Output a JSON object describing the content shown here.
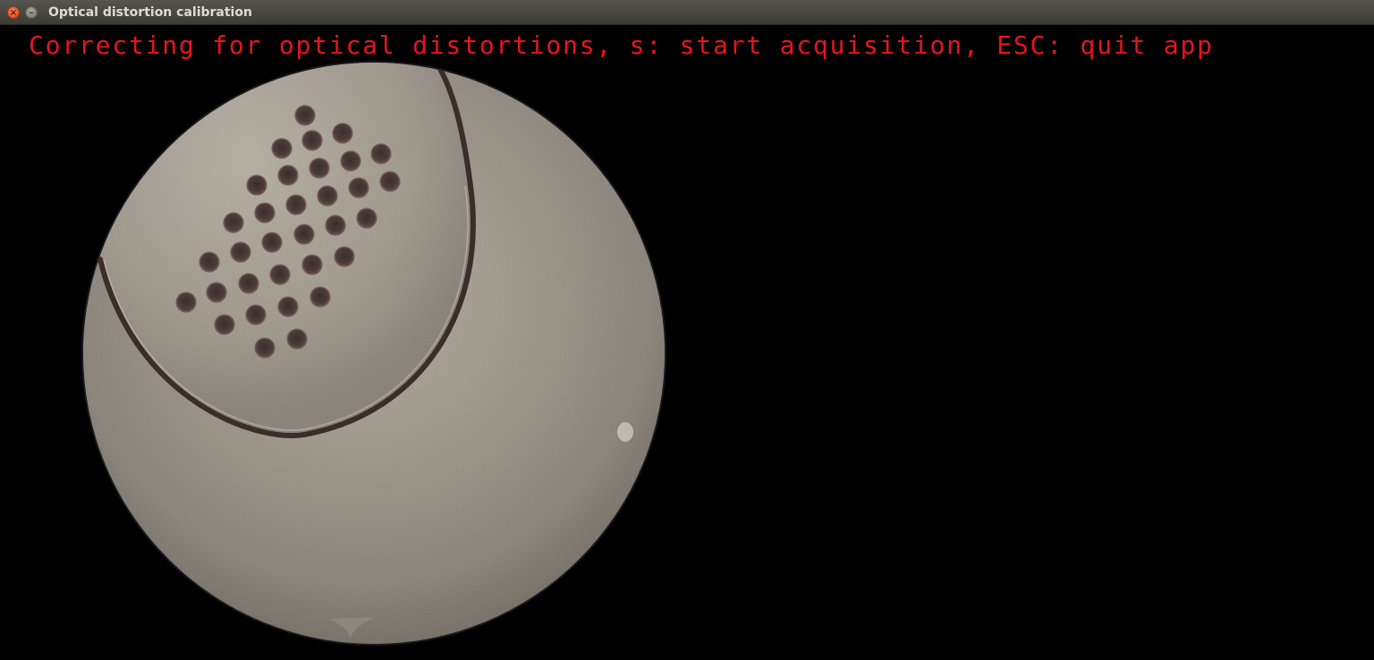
{
  "window": {
    "title": "Optical distortion calibration",
    "close_glyph": "×",
    "minimize_glyph": "–"
  },
  "overlay": {
    "instructions": "Correcting for optical distortions, s: start acquisition, ESC: quit app",
    "color": "#e8141c"
  },
  "icons": {
    "close": "close-icon",
    "minimize": "minimize-icon"
  }
}
